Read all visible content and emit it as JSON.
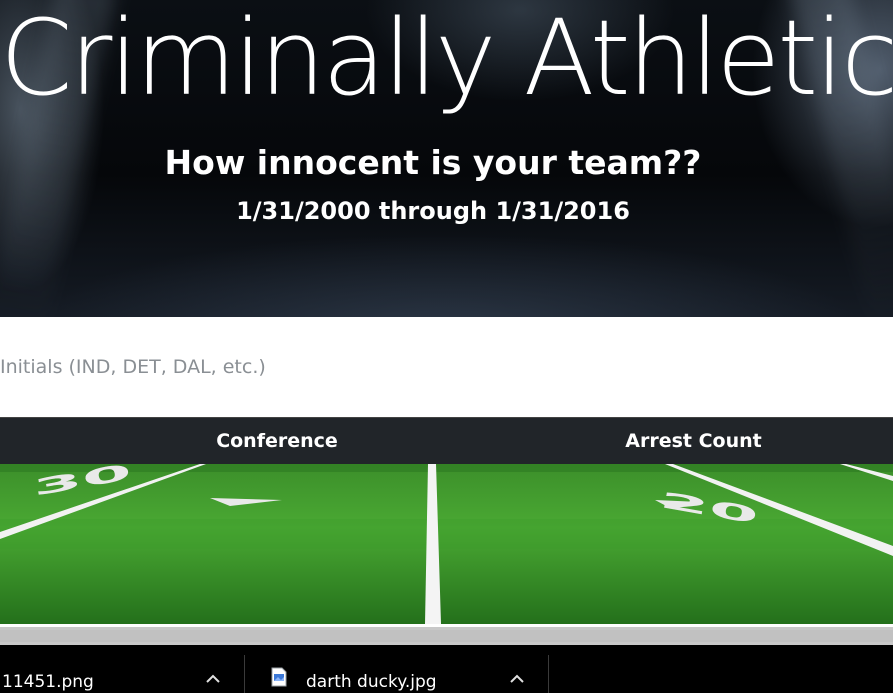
{
  "hero": {
    "title": "Criminally Athletic",
    "subtitle": "How innocent is your team??",
    "date_range": "1/31/2000 through 1/31/2016"
  },
  "search": {
    "placeholder": "Initials (IND, DET, DAL, etc.)",
    "value": ""
  },
  "table": {
    "columns": [
      "Conference",
      "Arrest Count"
    ]
  },
  "field": {
    "yard_markers": [
      "30",
      "20"
    ]
  },
  "downloads": {
    "items": [
      {
        "filename": "11451.png",
        "icon": "image-file-icon"
      },
      {
        "filename": "darth ducky.jpg",
        "icon": "image-file-icon"
      }
    ]
  },
  "colors": {
    "table_header_bg": "#212529",
    "field_green": "#3f9a2c",
    "downloads_bg": "#000000"
  }
}
